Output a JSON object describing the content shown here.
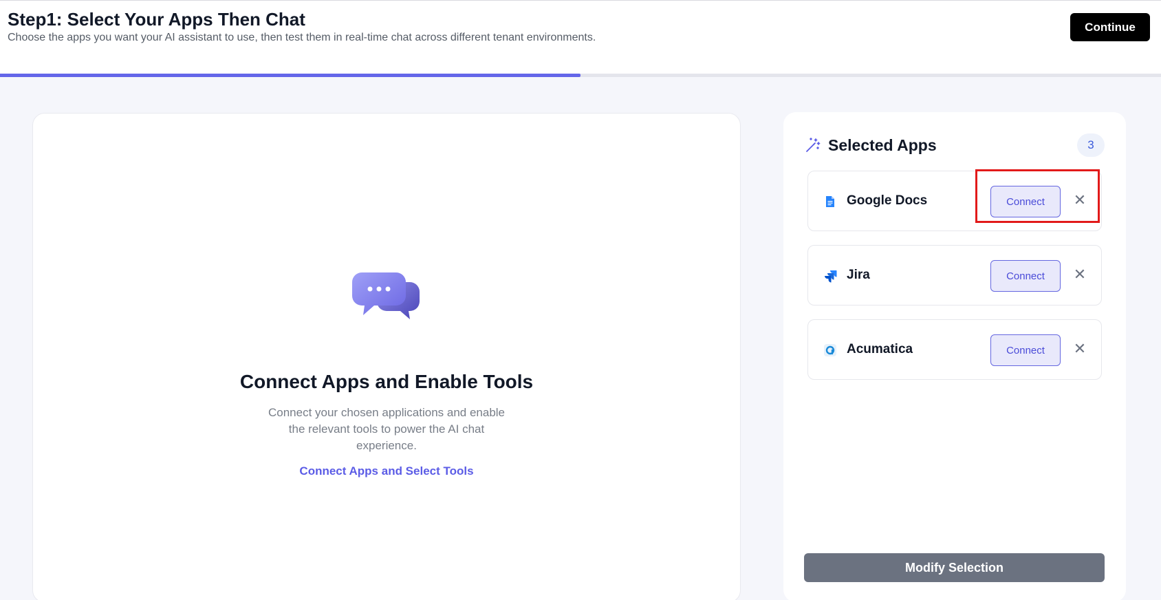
{
  "header": {
    "title": "Step1: Select Your Apps Then Chat",
    "subtitle": "Choose the apps you want your AI assistant to use, then test them in real-time chat across different tenant environments.",
    "continue_label": "Continue"
  },
  "progress": {
    "fraction": 0.5
  },
  "empty_state": {
    "illustration_icon": "chat-bubbles-icon",
    "title": "Connect Apps and Enable Tools",
    "description": "Connect your chosen applications and enable the relevant tools to power the AI chat experience.",
    "link_label": "Connect Apps and Select Tools"
  },
  "selected_apps": {
    "title": "Selected Apps",
    "title_icon": "magic-wand-icon",
    "count": "3",
    "items": [
      {
        "name": "Google Docs",
        "icon": "google-docs-icon",
        "connect_label": "Connect",
        "remove_icon": "close-icon"
      },
      {
        "name": "Jira",
        "icon": "jira-icon",
        "connect_label": "Connect",
        "remove_icon": "close-icon"
      },
      {
        "name": "Acumatica",
        "icon": "acumatica-icon",
        "connect_label": "Connect",
        "remove_icon": "close-icon"
      }
    ],
    "modify_label": "Modify Selection"
  },
  "colors": {
    "accent": "#6466e9",
    "highlight": "#e21a1a",
    "connect_bg": "#e9e9fb",
    "modify_bg": "#6b7280"
  }
}
